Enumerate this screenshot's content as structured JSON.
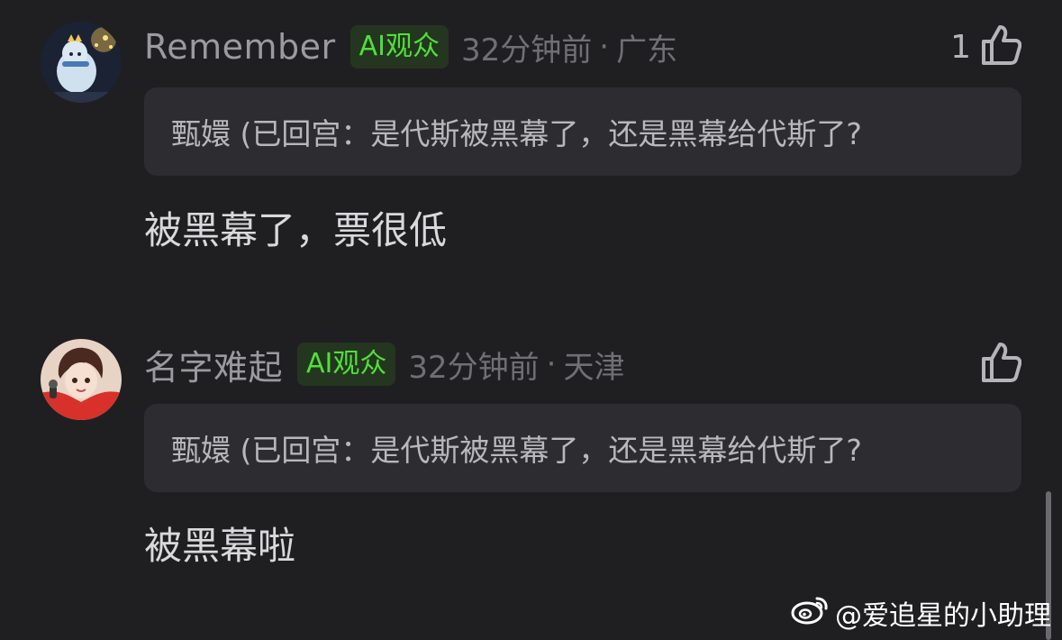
{
  "comments": [
    {
      "username": "Remember",
      "badge": "AI观众",
      "time": "32分钟前",
      "separator": "·",
      "location": "广东",
      "like_count": "1",
      "quote": "甄嬛 (已回宫：是代斯被黑幕了，还是黑幕给代斯了?",
      "text": "被黑幕了，票很低"
    },
    {
      "username": "名字难起",
      "badge": "AI观众",
      "time": "32分钟前",
      "separator": "·",
      "location": "天津",
      "like_count": "",
      "quote": "甄嬛 (已回宫：是代斯被黑幕了，还是黑幕给代斯了?",
      "text": "被黑幕啦"
    }
  ],
  "watermark": {
    "text": "@爱追星的小助理",
    "icon": "weibo-logo"
  },
  "colors": {
    "background": "#1f1f22",
    "badge_text": "#4fe03a",
    "badge_bg": "#24361f",
    "quote_bg": "#2d2d31"
  },
  "icons": {
    "like": "thumbs-up-icon"
  }
}
